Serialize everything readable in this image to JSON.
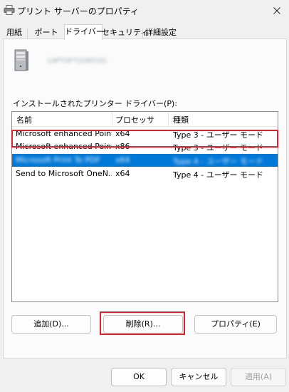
{
  "window": {
    "title": "プリント サーバーのプロパティ"
  },
  "icons": {
    "title": "printer-icon",
    "close": "close-icon",
    "server": "computer-tower-icon"
  },
  "tabs": [
    {
      "label": "用紙",
      "active": false
    },
    {
      "label": "ポート",
      "active": false
    },
    {
      "label": "ドライバー",
      "active": true
    },
    {
      "label": "セキュリティ",
      "active": false
    },
    {
      "label": "詳細設定",
      "active": false
    }
  ],
  "server": {
    "name": "LAPTOP-T2H8IYUG"
  },
  "drivers": {
    "label": "インストールされたプリンター ドライバー(P):",
    "columns": [
      "名前",
      "プロセッサ",
      "種類"
    ],
    "rows": [
      {
        "name": "Microsoft enhanced Point...",
        "processor": "x64",
        "type": "Type 3 - ユーザー モード",
        "selected": false
      },
      {
        "name": "Microsoft enhanced Point...",
        "processor": "x86",
        "type": "Type 3 - ユーザー モード",
        "selected": false
      },
      {
        "name": "Microsoft Print To PDF",
        "processor": "x64",
        "type": "Type 4 - ユーザー モード",
        "selected": true
      },
      {
        "name": "Send to Microsoft OneN...",
        "processor": "x64",
        "type": "Type 4 - ユーザー モード",
        "selected": false
      }
    ]
  },
  "buttons": {
    "add": "追加(D)...",
    "remove": "削除(R)...",
    "properties": "プロパティ(E)",
    "ok": "OK",
    "cancel": "キャンセル",
    "apply": "適用(A)"
  },
  "colors": {
    "selection": "#0078d7",
    "highlight": "#e0202a"
  }
}
